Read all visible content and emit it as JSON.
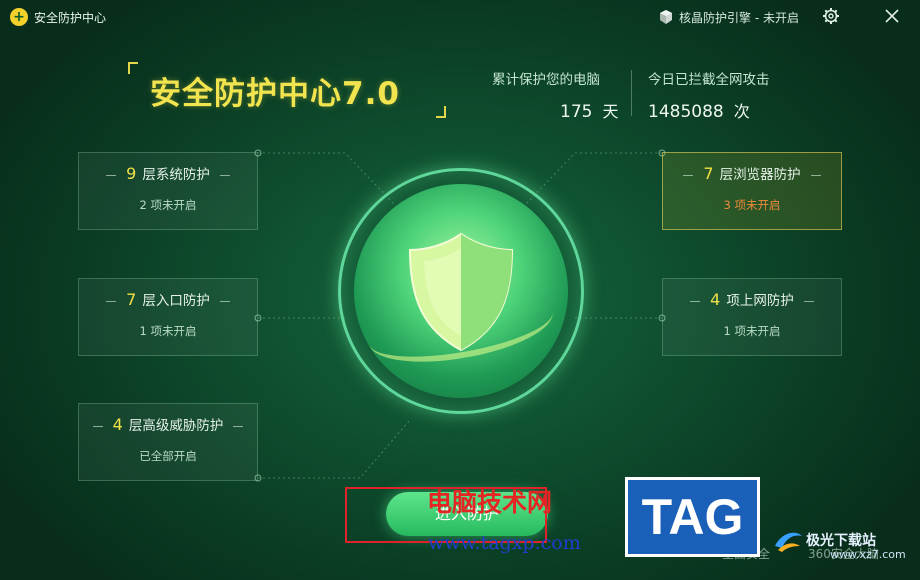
{
  "window": {
    "title": "安全防护中心",
    "kernel_badge": "核晶防护引擎 - 未开启"
  },
  "headline": "安全防护中心7.0",
  "stats": [
    {
      "label": "累计保护您的电脑",
      "value": "175",
      "unit": "天"
    },
    {
      "label": "今日已拦截全网攻击",
      "value": "1485088",
      "unit": "次"
    }
  ],
  "cards": [
    {
      "num": "9",
      "title": "层系统防护",
      "status": "2 项未开启",
      "warning": false
    },
    {
      "num": "7",
      "title": "层入口防护",
      "status": "1 项未开启",
      "warning": false
    },
    {
      "num": "4",
      "title": "层高级威胁防护",
      "status": "已全部开启",
      "warning": false
    },
    {
      "num": "7",
      "title": "层浏览器防护",
      "status": "3 项未开启",
      "warning": true
    },
    {
      "num": "4",
      "title": "项上网防护",
      "status": "1 项未开启",
      "warning": false
    }
  ],
  "enter_button": "进入防护",
  "footer": {
    "left": "全面安全",
    "right": "360安全大脑"
  },
  "watermark": {
    "site": "电脑技术网",
    "url": "www.tagxp.com",
    "tag": "TAG",
    "logo_text": "极光下载站",
    "logo_url": "www.xz7.com"
  },
  "colors": {
    "accent_yellow": "#f3e146",
    "warning_orange": "#ee8a3a",
    "background_green": "#0f5030",
    "ring_green": "#5fd79a"
  },
  "icons": {
    "app_logo": "plus-shield-icon",
    "kernel": "cube-icon",
    "settings": "gear-icon",
    "close": "close-icon",
    "center": "shield-icon"
  }
}
